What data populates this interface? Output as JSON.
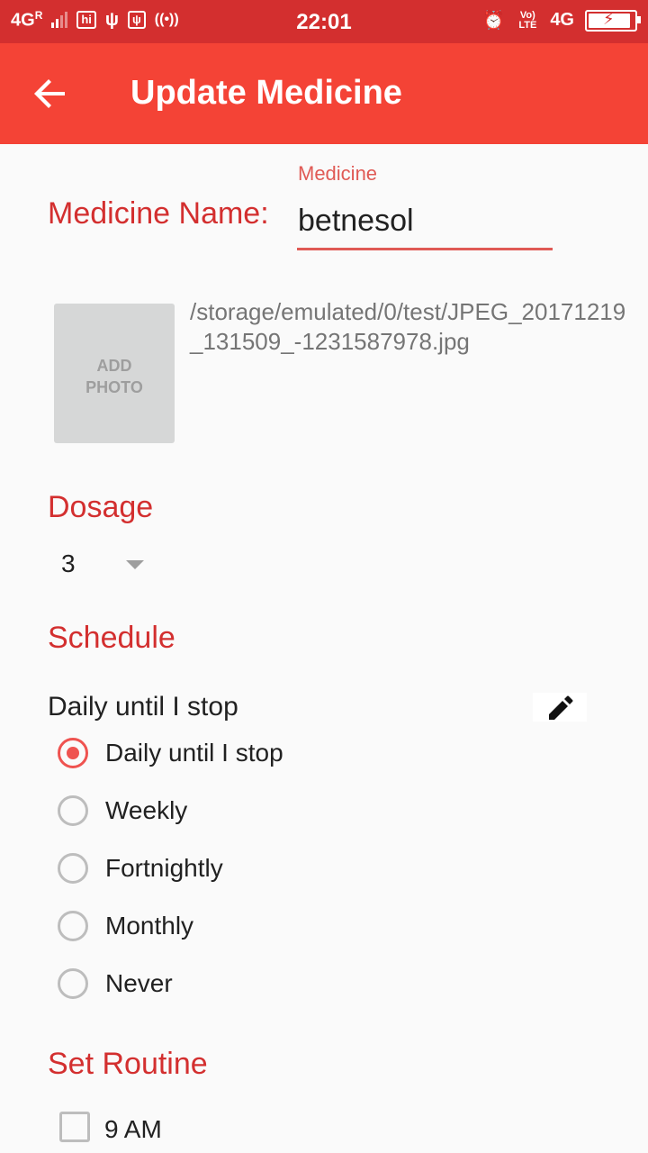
{
  "status_bar": {
    "network_left": "4G",
    "roaming": "R",
    "time": "22:01",
    "volte": "Vo) LTE",
    "network_right": "4G"
  },
  "app_bar": {
    "title": "Update Medicine",
    "back_icon": "arrow-back-icon"
  },
  "form": {
    "medicine_name_label": "Medicine Name:",
    "medicine_field_hint": "Medicine",
    "medicine_name_value": "betnesol",
    "add_photo_line1": "ADD",
    "add_photo_line2": "PHOTO",
    "photo_path": "/storage/emulated/0/test/JPEG_20171219_131509_-1231587978.jpg",
    "dosage_label": "Dosage",
    "dosage_value": "3",
    "schedule_label": "Schedule",
    "schedule_summary": "Daily until I stop",
    "schedule_options": [
      {
        "label": "Daily until I stop",
        "selected": true
      },
      {
        "label": "Weekly",
        "selected": false
      },
      {
        "label": "Fortnightly",
        "selected": false
      },
      {
        "label": "Monthly",
        "selected": false
      },
      {
        "label": "Never",
        "selected": false
      }
    ],
    "routine_label": "Set Routine",
    "routine_items": [
      {
        "label": "9 AM",
        "checked": false
      }
    ]
  },
  "colors": {
    "status_bar": "#d32f2f",
    "app_bar": "#f44336",
    "accent": "#ef5350",
    "label": "#d32f2f"
  }
}
